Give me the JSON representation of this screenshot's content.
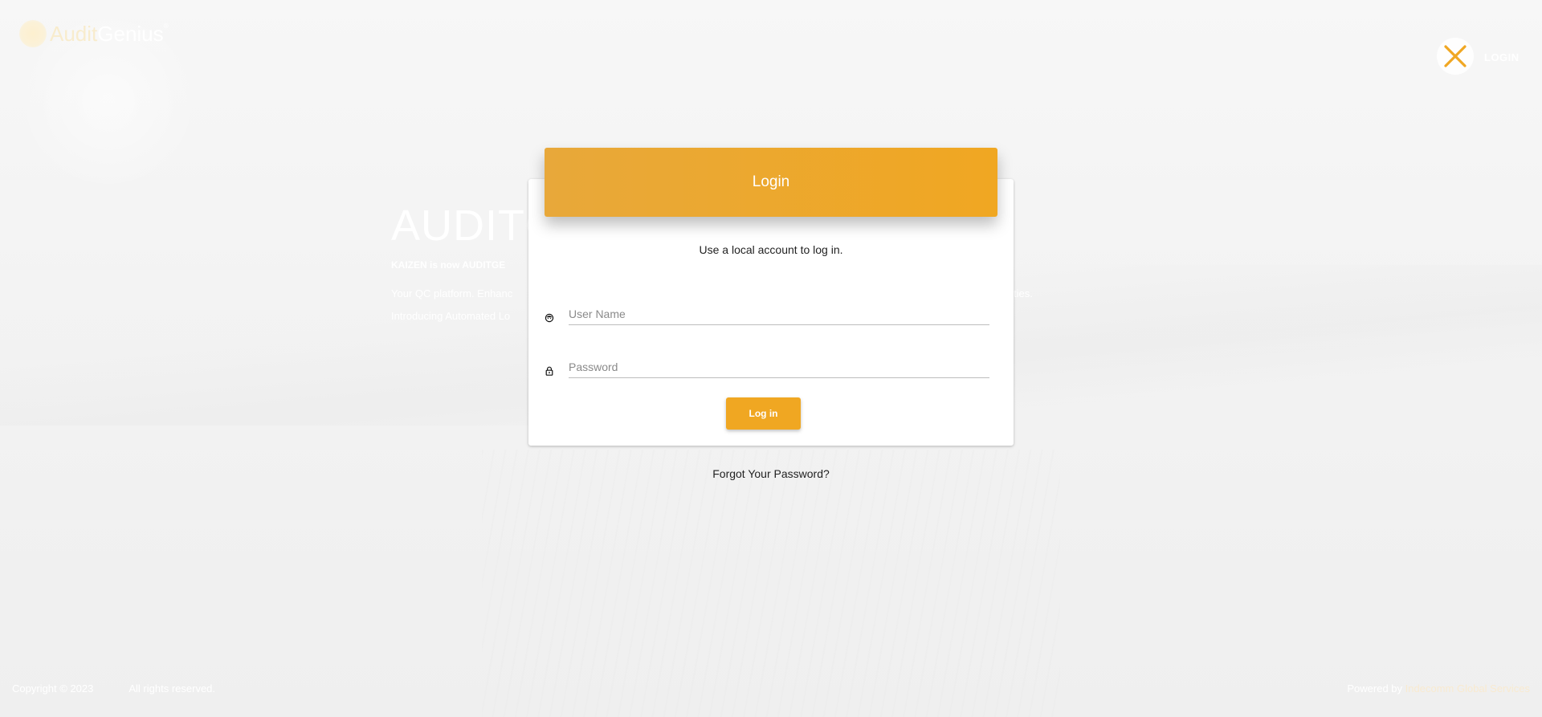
{
  "colors": {
    "accent": "#f0a722",
    "header_gradient_start": "#e8a83a",
    "background": "#f3f3f3"
  },
  "brand": {
    "name_part1": "Audit",
    "name_part2": "Genius",
    "trademark": "®",
    "icon": "brand-logo-icon"
  },
  "nav": {
    "close_icon": "close-icon",
    "login_label": "LOGIN"
  },
  "hero": {
    "title": "AUDITG",
    "subtitle": "KAIZEN is now AUDITGE",
    "paragraph1": "Your QC platform. Enhanc",
    "paragraph1_end": "ties.",
    "paragraph2": "Introducing Automated Lo"
  },
  "login_card": {
    "title": "Login",
    "subtitle": "Use a local account to log in.",
    "username": {
      "icon": "user-icon",
      "placeholder": "User Name",
      "value": ""
    },
    "password": {
      "icon": "lock-icon",
      "placeholder": "Password",
      "value": ""
    },
    "submit_label": "Log in",
    "forgot_label": "Forgot Your Password?"
  },
  "footer": {
    "copyright": "Copyright © 2023",
    "rights": "All rights reserved.",
    "powered_by": "Powered by",
    "company": "Indecomm Global Services"
  }
}
